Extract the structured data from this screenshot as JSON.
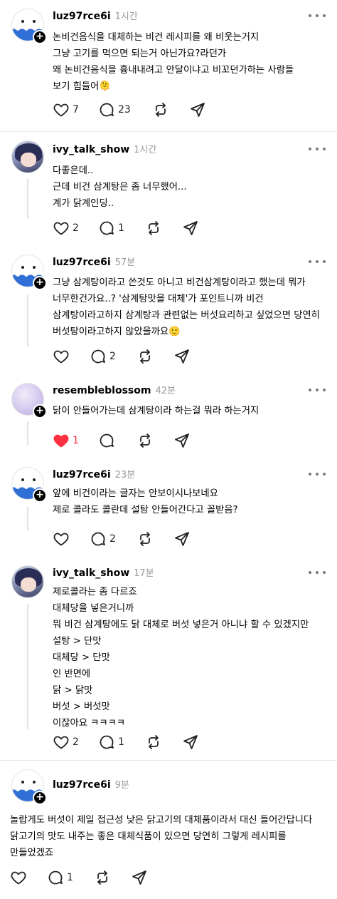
{
  "posts": [
    {
      "username": "luz97rce6i",
      "time": "1시간",
      "avatar": "egg-avatar",
      "text": "논비건음식을 대체하는 비건 레시피를 왜 비웃는거지\n그냥 고기를 먹으면 되는거 아닌가요?라던가\n왜 논비건음식을 흉내내려고 안달이냐고 비꼬던가하는  사람들\n보기 힘들어🫠",
      "likes": "7",
      "replies": "23",
      "liked": false
    },
    {
      "username": "ivy_talk_show",
      "time": "1시간",
      "avatar": "anime-avatar",
      "text": "다좋은데..\n근데 비건 삼계탕은 좀 너무했어...\n계가 닭계인딩..",
      "likes": "2",
      "replies": "1",
      "liked": false
    },
    {
      "username": "luz97rce6i",
      "time": "57분",
      "avatar": "egg-avatar",
      "text": "그냥 삼계탕이라고 쓴것도 아니고 비건삼계탕이라고 했는데 뭐가\n너무한건가요..? '삼계탕맛을 대체'가 포인트니까 비건\n삼계탕이라고하지 삼계탕과 관련없는 버섯요리하고 싶었으면 당연히\n버섯탕이라고하지 않았을까요🙂",
      "likes": "",
      "replies": "2",
      "liked": false
    },
    {
      "username": "resembleblossom",
      "time": "42분",
      "avatar": "blossom-avatar",
      "text": "닭이 안들어가는데 삼계탕이라 하는걸 뭐라 하는거지",
      "likes": "1",
      "replies": "",
      "liked": true
    },
    {
      "username": "luz97rce6i",
      "time": "23분",
      "avatar": "egg-avatar",
      "text": "앞에 비건이라는 글자는 안보이시나보네요\n제로 콜라도 콜란데 설탕 안들어간다고 꼴받음?",
      "likes": "",
      "replies": "2",
      "liked": false
    },
    {
      "username": "ivy_talk_show",
      "time": "17분",
      "avatar": "anime-avatar",
      "text": "제로콜라는 좀 다르죠\n대체당을 넣은거니까\n뭐 비건 삼계탕에도 닭 대체로 버섯 넣은거 아니냐 할 수 있겠지만\n설탕 > 단맛\n대체당 > 단맛\n인 반면에\n닭 > 닭맛\n버섯 > 버섯맛\n이잖아요  ㅋㅋㅋㅋ",
      "likes": "2",
      "replies": "1",
      "liked": false
    },
    {
      "username": "luz97rce6i",
      "time": "9분",
      "avatar": "egg-avatar",
      "text": "놀랍게도 버섯이 제일 접근성 낮은 닭고기의 대체품이라서 대신 들어간답니다\n닭고기의 맛도 내주는 좋은 대체식품이 있으면 당연히 그렇게 레시피를\n만들었겠죠",
      "likes": "",
      "replies": "1",
      "liked": false
    }
  ],
  "icons": {
    "like": "heart-icon",
    "reply": "comment-icon",
    "repost": "repost-icon",
    "share": "send-icon",
    "more": "more-icon",
    "follow": "plus-icon"
  },
  "colors": {
    "liked": "#ff3040",
    "meta": "#9a9a9a"
  }
}
